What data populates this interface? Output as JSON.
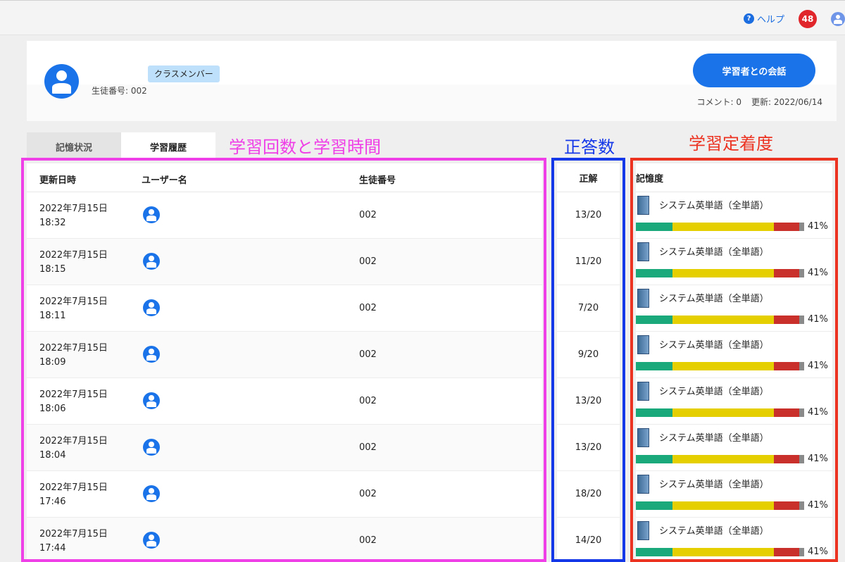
{
  "header": {
    "help_label": "ヘルプ",
    "help_icon": "question-icon",
    "notification_count": "48",
    "avatar_icon": "user-icon"
  },
  "profile": {
    "badge": "クラスメンバー",
    "student_number": "生徒番号: 002",
    "chat_button": "学習者との会話",
    "comment_count": "コメント: 0",
    "updated": "更新: 2022/06/14"
  },
  "tabs": [
    {
      "label": "記憶状況",
      "active": false
    },
    {
      "label": "学習履歴",
      "active": true
    }
  ],
  "annotations": {
    "left": "学習回数と学習時間",
    "middle": "正答数",
    "right": "学習定着度"
  },
  "columns": {
    "updated_at": "更新日時",
    "user_name": "ユーザー名",
    "student_no": "生徒番号",
    "correct": "正解",
    "memory": "記憶度"
  },
  "colors": {
    "accent": "#1a73e8",
    "annotation_left": "#ef3fe6",
    "annotation_middle": "#1438e8",
    "annotation_right": "#ec3322",
    "bar_green": "#19a97a",
    "bar_yellow": "#e6cf00",
    "bar_red": "#c9302c",
    "bar_gray": "#8a8a8a"
  },
  "rows": [
    {
      "date": "2022年7月15日",
      "time": "18:32",
      "student_no": "002",
      "correct": "13/20",
      "book": "システム英単語（全単語）",
      "memory": "41%"
    },
    {
      "date": "2022年7月15日",
      "time": "18:15",
      "student_no": "002",
      "correct": "11/20",
      "book": "システム英単語（全単語）",
      "memory": "41%"
    },
    {
      "date": "2022年7月15日",
      "time": "18:11",
      "student_no": "002",
      "correct": "7/20",
      "book": "システム英単語（全単語）",
      "memory": "41%"
    },
    {
      "date": "2022年7月15日",
      "time": "18:09",
      "student_no": "002",
      "correct": "9/20",
      "book": "システム英単語（全単語）",
      "memory": "41%"
    },
    {
      "date": "2022年7月15日",
      "time": "18:06",
      "student_no": "002",
      "correct": "13/20",
      "book": "システム英単語（全単語）",
      "memory": "41%"
    },
    {
      "date": "2022年7月15日",
      "time": "18:04",
      "student_no": "002",
      "correct": "13/20",
      "book": "システム英単語（全単語）",
      "memory": "41%"
    },
    {
      "date": "2022年7月15日",
      "time": "17:46",
      "student_no": "002",
      "correct": "18/20",
      "book": "システム英単語（全単語）",
      "memory": "41%"
    },
    {
      "date": "2022年7月15日",
      "time": "17:44",
      "student_no": "002",
      "correct": "14/20",
      "book": "システム英単語（全単語）",
      "memory": "41%"
    }
  ],
  "memory_bar_fractions": {
    "green": 0.22,
    "yellow": 0.61,
    "red": 0.15,
    "gray": 0.03
  }
}
